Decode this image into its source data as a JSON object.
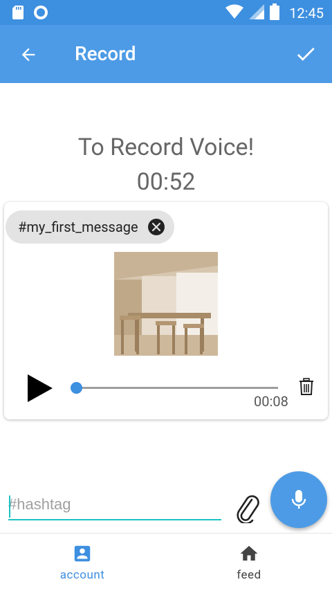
{
  "status_bar": {
    "time": "12:45"
  },
  "app_bar": {
    "title": "Record"
  },
  "main": {
    "heading": "To Record Voice!",
    "timer": "00:52"
  },
  "card": {
    "chip_label": "#my_first_message",
    "player": {
      "elapsed": "00:08",
      "progress": 0.0
    }
  },
  "composer": {
    "placeholder": "#hashtag"
  },
  "bottom_nav": {
    "items": [
      {
        "label": "account",
        "icon": "account-box-icon",
        "active": true
      },
      {
        "label": "feed",
        "icon": "home-icon",
        "active": false
      }
    ]
  },
  "colors": {
    "primary": "#4d9be6",
    "status_bar": "#3d8fe0",
    "accent": "#1cc2c2",
    "chip_bg": "#e3e3e3"
  }
}
